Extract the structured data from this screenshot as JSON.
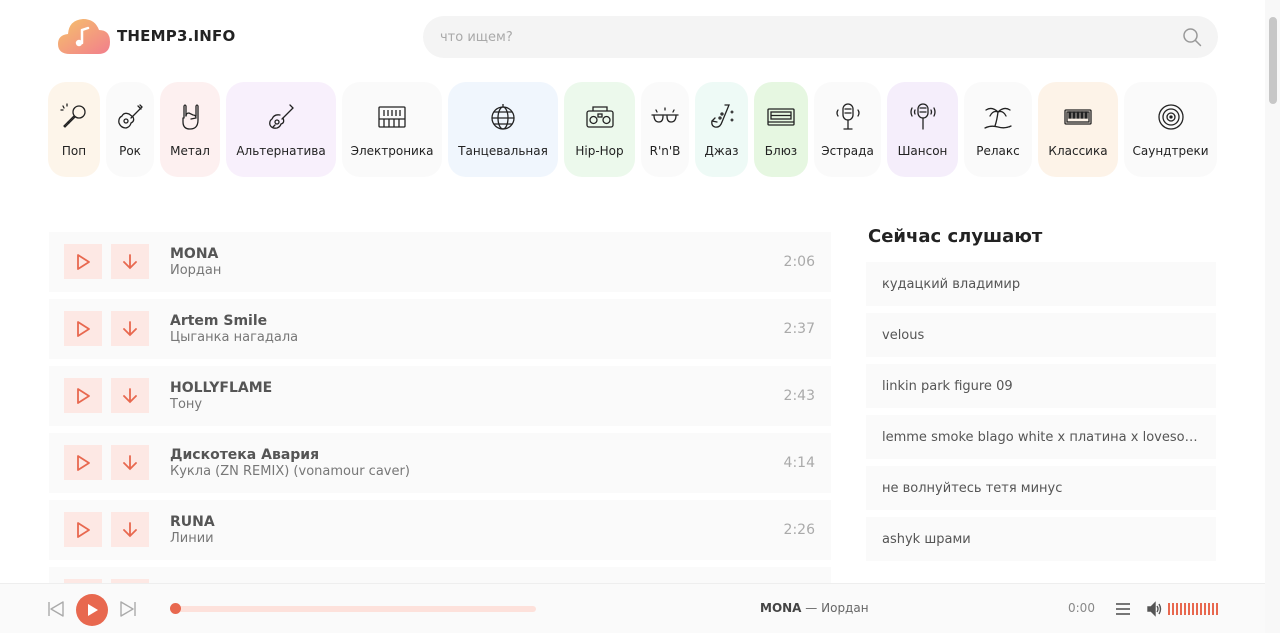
{
  "site": {
    "name": "THEMP3.INFO"
  },
  "search": {
    "placeholder": "что ищем?"
  },
  "colors": {
    "accent": "#e8684f",
    "accent_light": "#fde8e4"
  },
  "genres": [
    {
      "label": "Поп",
      "icon": "microphone-icon",
      "bg": "#fdf5ea"
    },
    {
      "label": "Рок",
      "icon": "electric-guitar-icon",
      "bg": "#fafafa"
    },
    {
      "label": "Метал",
      "icon": "rock-hand-icon",
      "bg": "#fdf0f0"
    },
    {
      "label": "Альтернатива",
      "icon": "guitar-icon",
      "bg": "#f8f0fc"
    },
    {
      "label": "Электроника",
      "icon": "synthesizer-icon",
      "bg": "#fafafa"
    },
    {
      "label": "Танцевальная",
      "icon": "disco-ball-icon",
      "bg": "#f0f6fd"
    },
    {
      "label": "Hip-Hop",
      "icon": "boombox-icon",
      "bg": "#ecf9ec"
    },
    {
      "label": "R'n'B",
      "icon": "sunglasses-icon",
      "bg": "#fafafa"
    },
    {
      "label": "Джаз",
      "icon": "saxophone-icon",
      "bg": "#eefaf6"
    },
    {
      "label": "Блюз",
      "icon": "cassette-icon",
      "bg": "#e6f7e1"
    },
    {
      "label": "Эстрада",
      "icon": "retro-microphone-icon",
      "bg": "#fafafa"
    },
    {
      "label": "Шансон",
      "icon": "mic-stand-icon",
      "bg": "#f5eefb"
    },
    {
      "label": "Релакс",
      "icon": "palm-tree-icon",
      "bg": "#fafafa"
    },
    {
      "label": "Классика",
      "icon": "piano-icon",
      "bg": "#fdf3e8"
    },
    {
      "label": "Саундтреки",
      "icon": "vinyl-icon",
      "bg": "#fafafa"
    }
  ],
  "tracks": [
    {
      "artist": "MONA",
      "title": "Иордан",
      "duration": "2:06"
    },
    {
      "artist": "Artem Smile",
      "title": "Цыганка нагадала",
      "duration": "2:37"
    },
    {
      "artist": "HOLLYFLAME",
      "title": "Тону",
      "duration": "2:43"
    },
    {
      "artist": "Дискотека Авария",
      "title": "Кукла (ZN REMIX) (vonamour caver)",
      "duration": "4:14"
    },
    {
      "artist": "RUNA",
      "title": "Линии",
      "duration": "2:26"
    }
  ],
  "sidebar": {
    "title": "Сейчас слушают",
    "items": [
      "кудацкий владимир",
      "velous",
      "linkin park figure 09",
      "lemme smoke blago white x платина x lovesomeone",
      "не волнуйтесь тетя минус",
      "ashyk шрами"
    ]
  },
  "player": {
    "artist": "MONA",
    "separator": " — ",
    "title": "Иордан",
    "time": "0:00",
    "progress": 0
  }
}
